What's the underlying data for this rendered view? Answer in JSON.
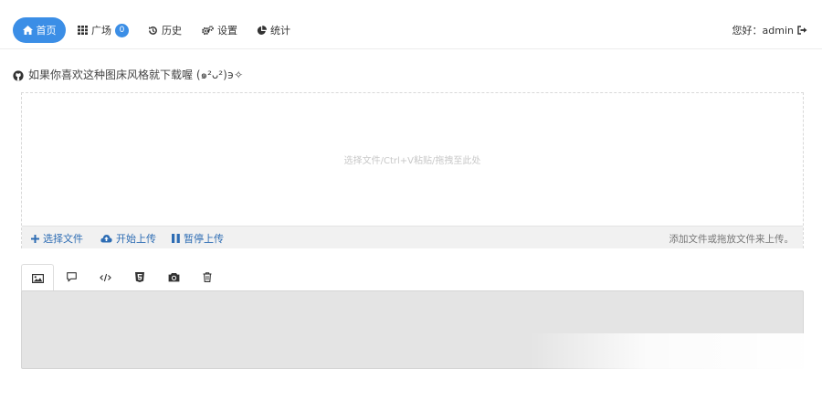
{
  "nav": {
    "home": "首页",
    "square": "广场",
    "square_count": "0",
    "history": "历史",
    "settings": "设置",
    "stats": "统计",
    "greeting": "您好：admin"
  },
  "tip": {
    "text": "如果你喜欢这种图床风格就下载喔 (๑²ᴗ²)϶✧",
    "icon": "github-icon"
  },
  "uploader": {
    "placeholder": "选择文件/Ctrl+V粘贴/拖拽至此处",
    "choose_label": "选择文件",
    "start_label": "开始上传",
    "pause_label": "暂停上传",
    "hint": "添加文件或拖放文件来上传。"
  },
  "tabs": [
    {
      "icon": "image-icon"
    },
    {
      "icon": "comment-icon"
    },
    {
      "icon": "code-icon"
    },
    {
      "icon": "html5-icon"
    },
    {
      "icon": "camera-icon"
    },
    {
      "icon": "trash-icon"
    }
  ],
  "colors": {
    "accent": "#3b8ee6",
    "link": "#2e6db4",
    "bar": "#f1f1f1",
    "result_bg": "#e4e4e4"
  }
}
